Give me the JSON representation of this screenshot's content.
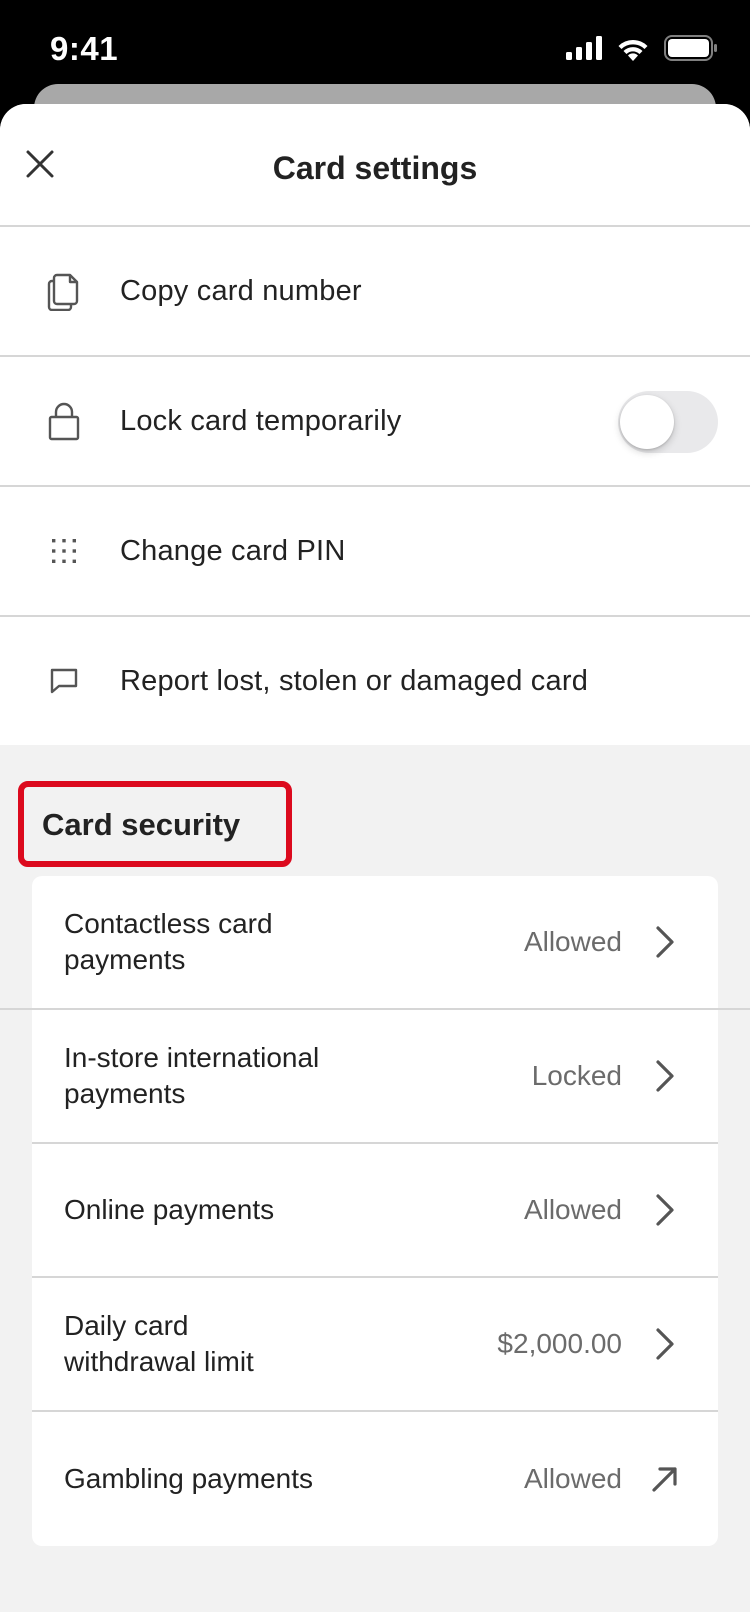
{
  "status_bar": {
    "time": "9:41"
  },
  "header": {
    "title": "Card settings"
  },
  "actions": [
    {
      "label": "Copy card number",
      "icon": "copy-icon"
    },
    {
      "label": "Lock card temporarily",
      "icon": "lock-icon",
      "toggle": false
    },
    {
      "label": "Change card PIN",
      "icon": "keypad-icon"
    },
    {
      "label": "Report lost, stolen or damaged card",
      "icon": "message-icon"
    }
  ],
  "security": {
    "title": "Card security",
    "highlight_color": "#dc0a1e",
    "rows": [
      {
        "label": "Contactless card payments",
        "value": "Allowed",
        "icon": "chevron-right-icon"
      },
      {
        "label": "In-store international payments",
        "value": "Locked",
        "icon": "chevron-right-icon"
      },
      {
        "label": "Online payments",
        "value": "Allowed",
        "icon": "chevron-right-icon"
      },
      {
        "label": "Daily card withdrawal limit",
        "value": "$2,000.00",
        "icon": "chevron-right-icon"
      },
      {
        "label": "Gambling payments",
        "value": "Allowed",
        "icon": "external-arrow-icon"
      }
    ]
  }
}
